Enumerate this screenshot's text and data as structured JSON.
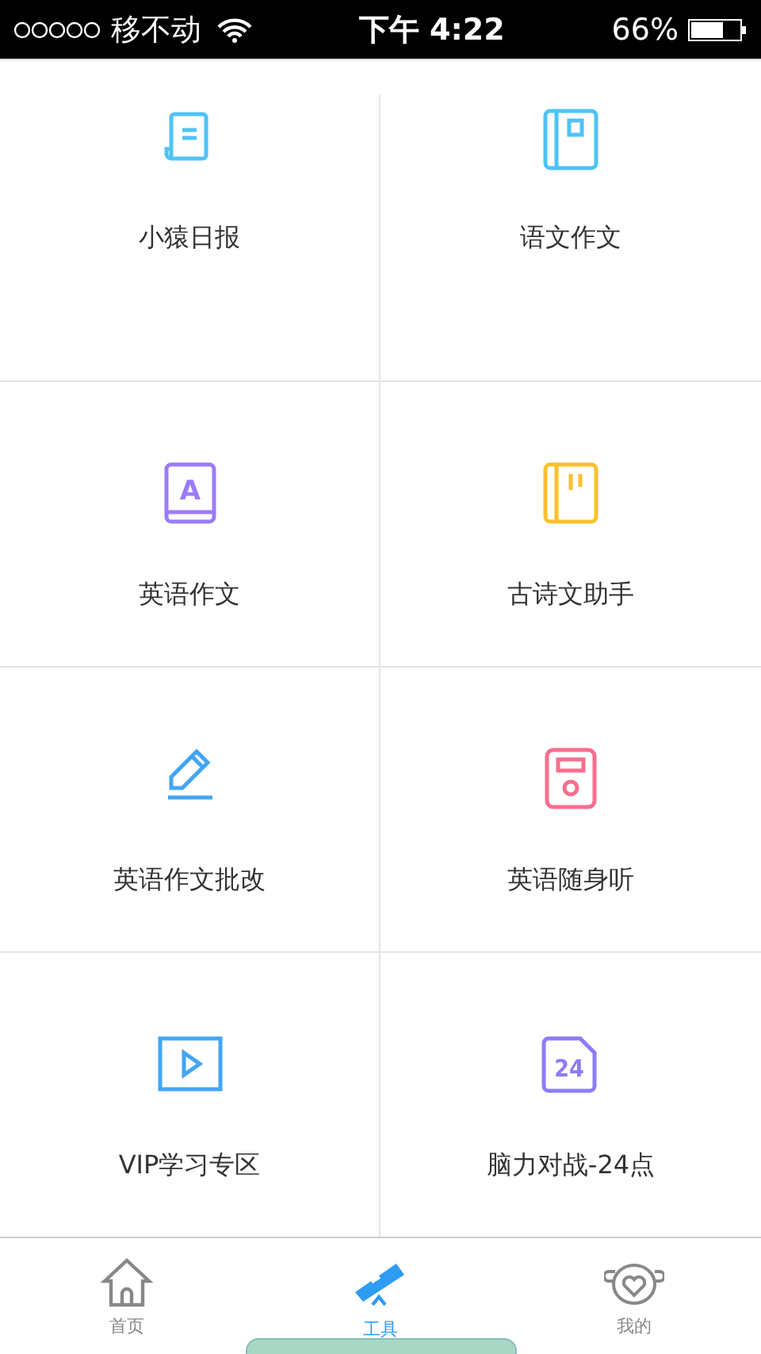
{
  "status_bar": {
    "carrier": "移不动",
    "time": "下午 4:22",
    "battery": "66%"
  },
  "tool_rows": [
    {
      "tools": [
        {
          "label": "小猿日报"
        },
        {
          "label": "语文作文"
        }
      ]
    },
    {
      "tools": [
        {
          "label": "英语作文",
          "icon_text": "A"
        },
        {
          "label": "古诗文助手"
        }
      ]
    },
    {
      "tools": [
        {
          "label": "英语作文批改"
        },
        {
          "label": "英语随身听"
        }
      ]
    },
    {
      "tools": [
        {
          "label": "VIP学习专区"
        },
        {
          "label": "脑力对战-24点",
          "icon_text": "24"
        }
      ]
    }
  ],
  "tab_bar": [
    {
      "label": "首页",
      "selected": false
    },
    {
      "label": "工具",
      "selected": true
    },
    {
      "label": "我的",
      "selected": false
    }
  ]
}
